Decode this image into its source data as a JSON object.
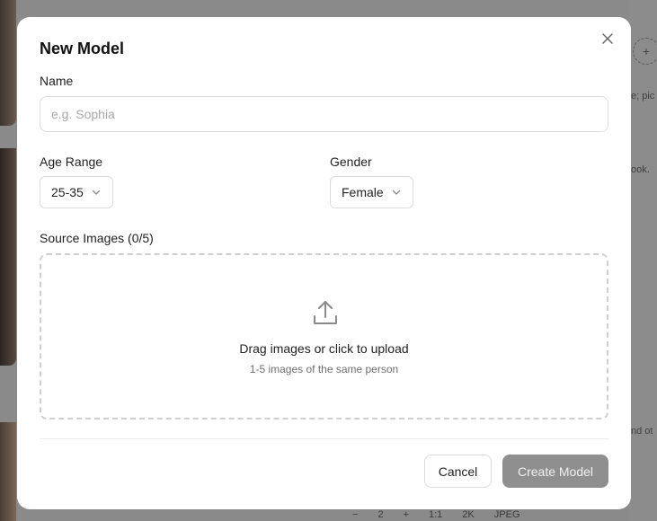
{
  "background": {
    "right_text_1": "e; pic",
    "right_text_2": "ook.",
    "right_text_3": "nd ot",
    "plus_symbol": "+",
    "bottom_bar": {
      "minus": "−",
      "count": "2",
      "plus": "+",
      "ratio": "1:1",
      "resolution": "2K",
      "format": "JPEG"
    }
  },
  "modal": {
    "title": "New Model",
    "close_icon": "close-icon",
    "name": {
      "label": "Name",
      "placeholder": "e.g. Sophia",
      "value": ""
    },
    "age_range": {
      "label": "Age Range",
      "selected": "25-35"
    },
    "gender": {
      "label": "Gender",
      "selected": "Female"
    },
    "source_images": {
      "label": "Source Images (0/5)",
      "drop_title": "Drag images or click to upload",
      "drop_subtitle": "1-5 images of the same person",
      "icon": "upload-icon"
    },
    "buttons": {
      "cancel": "Cancel",
      "create": "Create Model"
    }
  },
  "colors": {
    "overlay": "#7a7a7a",
    "create_button_disabled": "#8f8f8f",
    "border": "#dcdcdc"
  }
}
